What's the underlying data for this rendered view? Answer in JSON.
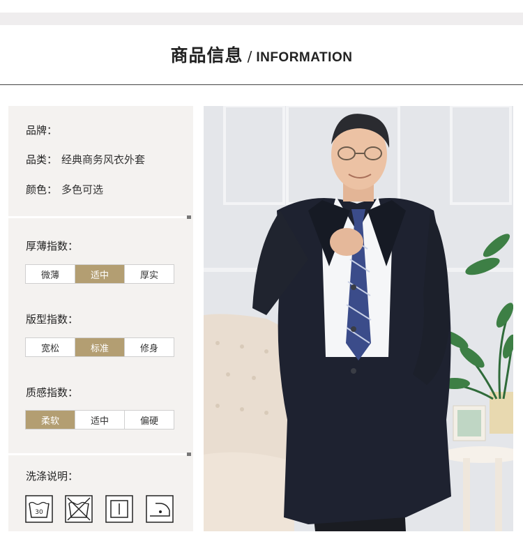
{
  "header": {
    "title_cn": "商品信息",
    "separator": "/",
    "title_en": "INFORMATION"
  },
  "info": {
    "brand_label": "品牌：",
    "brand_value": "",
    "category_label": "品类：",
    "category_value": "经典商务风衣外套",
    "color_label": "颜色：",
    "color_value": "多色可选"
  },
  "thickness": {
    "label": "厚薄指数：",
    "options": [
      "微薄",
      "适中",
      "厚实"
    ],
    "selected": "适中"
  },
  "fit": {
    "label": "版型指数：",
    "options": [
      "宽松",
      "标准",
      "修身"
    ],
    "selected": "标准"
  },
  "texture": {
    "label": "质感指数：",
    "options": [
      "柔软",
      "适中",
      "偏硬"
    ],
    "selected": "柔软"
  },
  "washing": {
    "label": "洗涤说明：",
    "icons": [
      "wash-30-icon",
      "no-bleach-icon",
      "tumble-dry-icon",
      "iron-low-icon"
    ],
    "wash_temp": "30"
  },
  "colors": {
    "accent": "#b39e72",
    "panel_bg": "#f4f2f0",
    "coat": "#1e2230"
  }
}
